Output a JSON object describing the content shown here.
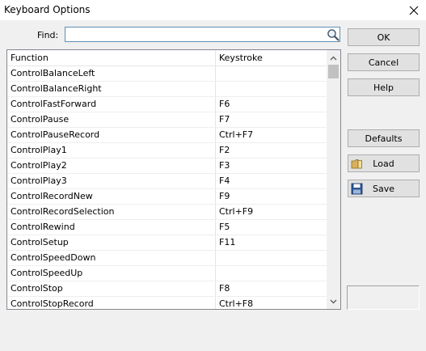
{
  "window": {
    "title": "Keyboard Options"
  },
  "find": {
    "label": "Find:",
    "value": "",
    "placeholder": ""
  },
  "table": {
    "headers": [
      "Function",
      "Keystroke"
    ],
    "rows": [
      [
        "ControlBalanceLeft",
        ""
      ],
      [
        "ControlBalanceRight",
        ""
      ],
      [
        "ControlFastForward",
        "F6"
      ],
      [
        "ControlPause",
        "F7"
      ],
      [
        "ControlPauseRecord",
        "Ctrl+F7"
      ],
      [
        "ControlPlay1",
        "F2"
      ],
      [
        "ControlPlay2",
        "F3"
      ],
      [
        "ControlPlay3",
        "F4"
      ],
      [
        "ControlRecordNew",
        "F9"
      ],
      [
        "ControlRecordSelection",
        "Ctrl+F9"
      ],
      [
        "ControlRewind",
        "F5"
      ],
      [
        "ControlSetup",
        "F11"
      ],
      [
        "ControlSpeedDown",
        ""
      ],
      [
        "ControlSpeedUp",
        ""
      ],
      [
        "ControlStop",
        "F8"
      ],
      [
        "ControlStopRecord",
        "Ctrl+F8"
      ]
    ]
  },
  "buttons": {
    "ok": "OK",
    "cancel": "Cancel",
    "help": "Help",
    "defaults": "Defaults",
    "load": "Load",
    "save": "Save"
  },
  "icons": {
    "close": "close-icon",
    "search": "search-icon",
    "load": "folder-icon",
    "save": "floppy-disk-icon",
    "scroll_up": "chevron-up-icon",
    "scroll_down": "chevron-down-icon"
  },
  "colors": {
    "window_bg": "#f0f0f0",
    "input_border": "#5f8fb4",
    "button_bg": "#e1e1e1",
    "button_border": "#adadad"
  }
}
